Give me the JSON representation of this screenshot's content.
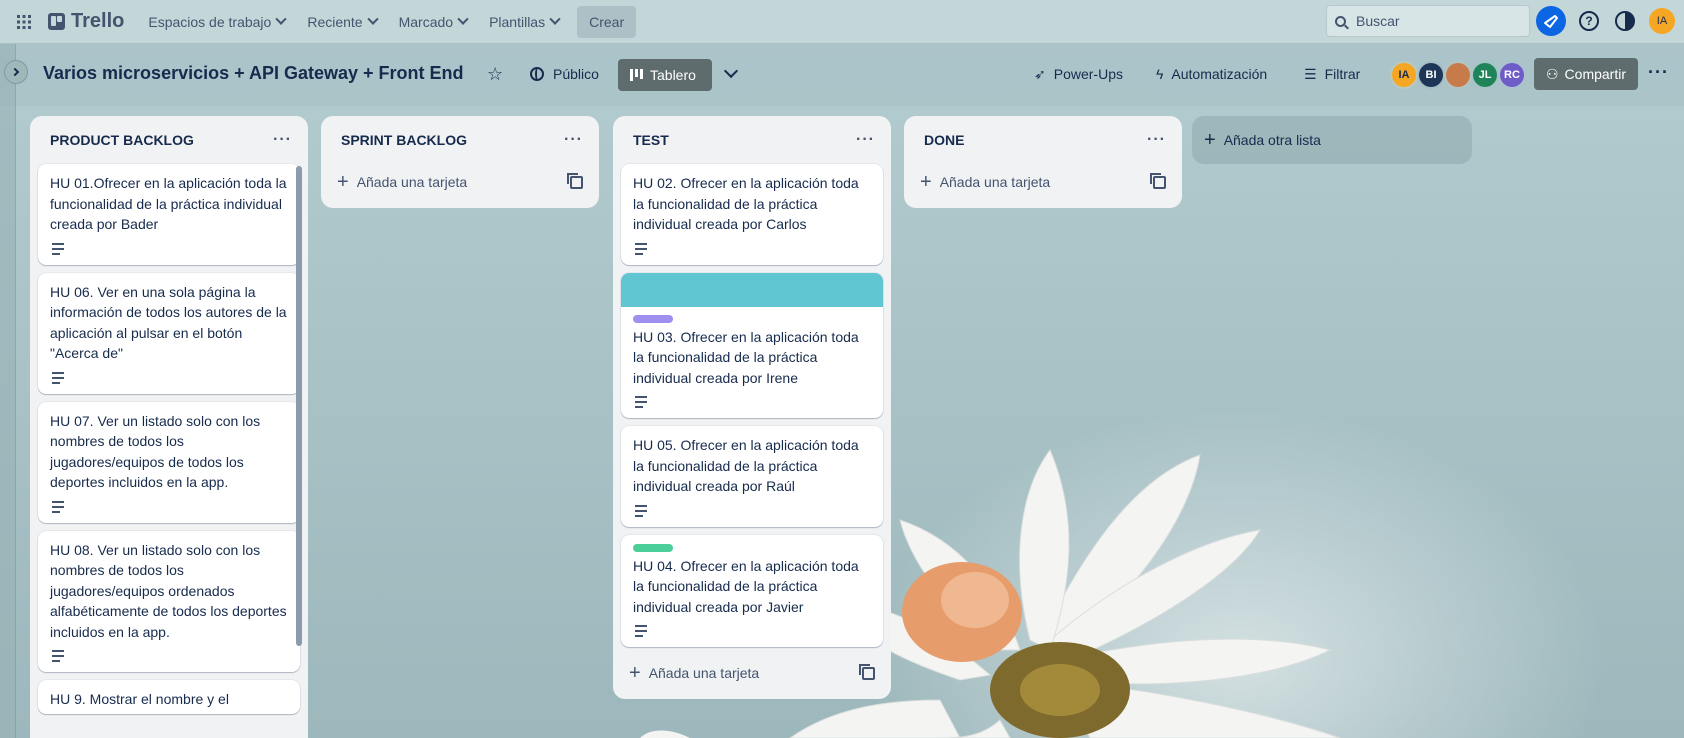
{
  "topbar": {
    "app_name": "Trello",
    "nav": {
      "workspaces": "Espacios de trabajo",
      "recent": "Reciente",
      "starred": "Marcado",
      "templates": "Plantillas"
    },
    "create_label": "Crear",
    "search_placeholder": "Buscar",
    "user_initials": "IA"
  },
  "board": {
    "title": "Varios microservicios + API Gateway + Front End",
    "visibility": "Público",
    "view_label": "Tablero",
    "powerups": "Power-Ups",
    "automation": "Automatización",
    "filter": "Filtrar",
    "share": "Compartir",
    "members": [
      {
        "initials": "IA",
        "color": "#f5a623"
      },
      {
        "initials": "BI",
        "color": "#1d3557"
      },
      {
        "initials": "",
        "color": "#c77b4a"
      },
      {
        "initials": "JL",
        "color": "#1f845a"
      },
      {
        "initials": "RC",
        "color": "#6e5dc6"
      }
    ]
  },
  "lists": [
    {
      "title": "PRODUCT BACKLOG",
      "cards": [
        {
          "text": "HU 01.Ofrecer en la aplicación toda la funcionalidad de la práctica individual creada por Bader"
        },
        {
          "text": "HU 06. Ver en una sola página la información de todos los autores de la aplicación al pulsar en el botón \"Acerca de\""
        },
        {
          "text": "HU 07. Ver un listado solo con los nombres de todos los jugadores/equipos de todos los deportes incluidos en la app."
        },
        {
          "text": "HU 08. Ver un listado solo con los nombres de todos los jugadores/equipos ordenados alfabéticamente de todos los deportes incluidos en la app."
        },
        {
          "text": "HU 9. Mostrar el nombre y el"
        }
      ]
    },
    {
      "title": "SPRINT BACKLOG",
      "add_card": "Añada una tarjeta"
    },
    {
      "title": "TEST",
      "cards": [
        {
          "text": "HU 02. Ofrecer en la aplicación toda la funcionalidad de la práctica individual creada por Carlos"
        },
        {
          "text": "HU 03. Ofrecer en la aplicación toda la funcionalidad de la práctica individual creada por Irene",
          "cover": "#60c6d2",
          "label_color": "#9f8fef"
        },
        {
          "text": "HU 05. Ofrecer en la aplicación toda la funcionalidad de la práctica individual creada por Raúl"
        },
        {
          "text": "HU 04. Ofrecer en la aplicación toda la funcionalidad de la práctica individual creada por Javier",
          "label_color": "#4bce97"
        }
      ],
      "add_card": "Añada una tarjeta"
    },
    {
      "title": "DONE",
      "add_card": "Añada una tarjeta"
    }
  ],
  "add_list": "Añada otra lista"
}
